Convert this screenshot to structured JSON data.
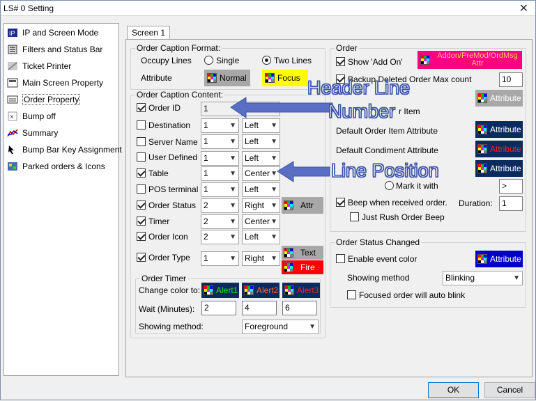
{
  "window": {
    "title": "LS# 0 Setting",
    "close": "✕"
  },
  "sidebar": {
    "items": [
      {
        "label": "IP and Screen Mode",
        "icon": "ip-icon"
      },
      {
        "label": "Filters and Status Bar",
        "icon": "filter-icon"
      },
      {
        "label": "Ticket Printer",
        "icon": "printer-icon"
      },
      {
        "label": "Main Screen Property",
        "icon": "screen-icon"
      },
      {
        "label": "Order Property",
        "icon": "order-icon"
      },
      {
        "label": "Bump off",
        "icon": "bump-icon"
      },
      {
        "label": "Summary",
        "icon": "summary-icon"
      },
      {
        "label": "Bump Bar Key Assignment",
        "icon": "bumpbar-icon"
      },
      {
        "label": "Parked orders & Icons",
        "icon": "parked-icon"
      }
    ]
  },
  "tab": {
    "label": "Screen 1"
  },
  "caption_format": {
    "title": "Order Caption Format:",
    "occupy_label": "Occupy Lines",
    "single": "Single",
    "two_lines": "Two Lines",
    "attribute_label": "Attribute",
    "normal": "Normal",
    "focus": "Focus"
  },
  "caption_content": {
    "title": "Order Caption Content:",
    "rows": [
      {
        "label": "Order ID",
        "checked": true,
        "line": "1",
        "pos": ""
      },
      {
        "label": "Destination",
        "checked": false,
        "line": "1",
        "pos": "Left"
      },
      {
        "label": "Server Name",
        "checked": false,
        "line": "1",
        "pos": "Left"
      },
      {
        "label": "User Defined",
        "checked": false,
        "line": "1",
        "pos": "Left"
      },
      {
        "label": "Table",
        "checked": true,
        "line": "1",
        "pos": "Center"
      },
      {
        "label": "POS terminal",
        "checked": false,
        "line": "1",
        "pos": "Left"
      },
      {
        "label": "Order Status",
        "checked": true,
        "line": "2",
        "pos": "Right"
      },
      {
        "label": "Timer",
        "checked": true,
        "line": "2",
        "pos": "Center"
      },
      {
        "label": "Order Icon",
        "checked": true,
        "line": "2",
        "pos": "Left"
      },
      {
        "label": "Order Type",
        "checked": true,
        "line": "1",
        "pos": "Right"
      }
    ],
    "attr_btn": "Attr",
    "text_btn": "Text",
    "fire_btn": "Fire"
  },
  "order_timer": {
    "title": "Order Timer",
    "change_color": "Change color to:",
    "alert1": "Alert1",
    "alert2": "Alert2",
    "alert3": "Alert3",
    "wait_label": "Wait (Minutes):",
    "wait1": "2",
    "wait2": "4",
    "wait3": "6",
    "showing_label": "Showing method:",
    "showing_value": "Foreground"
  },
  "order": {
    "title": "Order",
    "show_add_on": "Show 'Add On'",
    "addon_btn": "Addon/PreMod/OrdMsg Attr",
    "backup": "Backup Deleted Order Max count",
    "backup_value": "10",
    "attribute_btn": "Attribute",
    "partial_item": "r Item",
    "default_item": "Default Order Item Attribute",
    "default_condiment": "Default Condiment Attribute",
    "attr1": "Attribute",
    "attr2": "Attribute",
    "attr3": "Attribute",
    "mark_it_with": "Mark it with",
    "mark_value": ">",
    "beep": "Beep when received order.",
    "duration_label": "Duration:",
    "duration_value": "1",
    "rush_beep": "Just Rush Order Beep"
  },
  "status_changed": {
    "title": "Order Status Changed",
    "enable": "Enable event color",
    "attribute": "Attribute",
    "showing_label": "Showing method",
    "showing_value": "Blinking",
    "auto_blink": "Focused order will auto blink"
  },
  "footer": {
    "ok": "OK",
    "cancel": "Cancel"
  },
  "callouts": {
    "header_line": "Header Line",
    "number": "Number",
    "line_position": "Line Position"
  },
  "colors": {
    "callout": "#5a6fc4",
    "focus_yellow": "#ffff00",
    "attr_navy": "#0b2a5e",
    "fire_red": "#ff0000",
    "addon_magenta": "#ff0080"
  }
}
